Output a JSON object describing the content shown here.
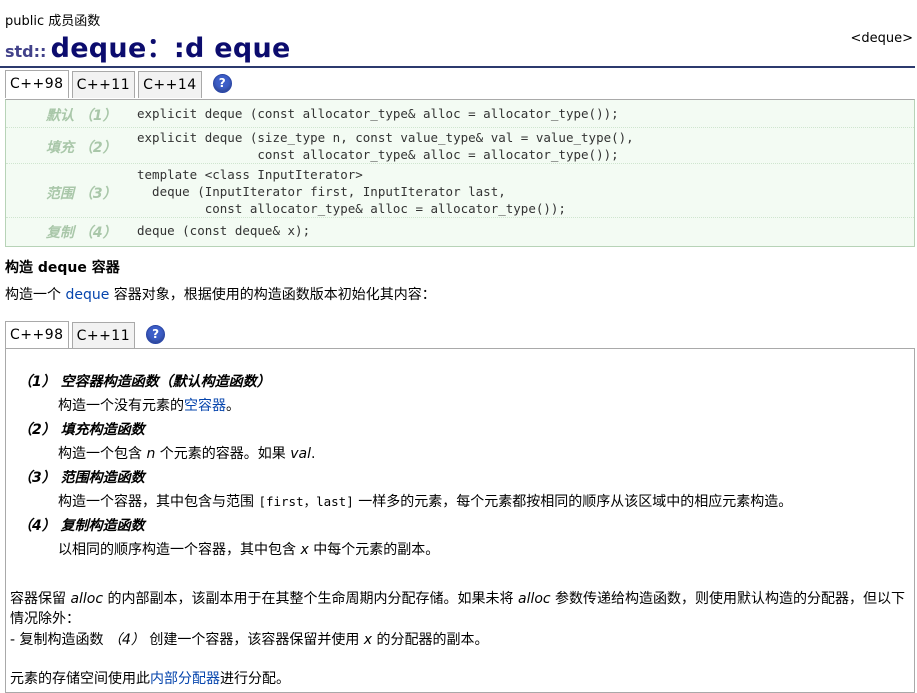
{
  "page": {
    "category": "public 成员函数",
    "namespace": "std::",
    "title": "deque：:d eque",
    "header_ref": "<deque>"
  },
  "proto_tabs": {
    "tabs": [
      "C++98",
      "C++11",
      "C++14"
    ],
    "active": "C++98",
    "help_icon": "?"
  },
  "prototypes": [
    {
      "label": "默认 （1）",
      "code": "explicit deque (const allocator_type& alloc = allocator_type());"
    },
    {
      "label": "填充 （2）",
      "code": "explicit deque (size_type n, const value_type& val = value_type(),\n                const allocator_type& alloc = allocator_type());"
    },
    {
      "label": "范围 （3）",
      "code": "template <class InputIterator>\n  deque (InputIterator first, InputIterator last,\n         const allocator_type& alloc = allocator_type());"
    },
    {
      "label": "复制 （4）",
      "code": "deque (const deque& x);"
    }
  ],
  "section": {
    "title": "构造 deque 容器",
    "intro_prefix": "构造一个",
    "intro_link": "deque",
    "intro_suffix": "容器对象，根据使用的构造函数版本初始化其内容："
  },
  "detail_tabs": {
    "tabs": [
      "C++98",
      "C++11"
    ],
    "active": "C++98",
    "help_icon": "?"
  },
  "items": [
    {
      "head": "（1） 空容器构造函数（默认构造函数）",
      "desc_pre": "构造一个没有元素的",
      "desc_link": "空容器",
      "desc_post": "。"
    },
    {
      "head": "（2） 填充构造函数",
      "desc_pre": "构造一个包含 ",
      "desc_var": "n",
      "desc_mid": " 个元素的容器。如果 ",
      "desc_var2": "val",
      "desc_post": "."
    },
    {
      "head": "（3） 范围构造函数",
      "desc_pre": "构造一个容器，其中包含与范围 ",
      "desc_range": "[first，last]",
      "desc_post": " 一样多的元素，每个元素都按相同的顺序从该区域中的相应元素构造。"
    },
    {
      "head": "（4） 复制构造函数",
      "desc_pre": "以相同的顺序构造一个容器，其中包含 ",
      "desc_var": "x",
      "desc_post": " 中每个元素的副本。"
    }
  ],
  "alloc_note": {
    "p1_a": "容器保留 ",
    "p1_var": "alloc",
    "p1_b": " 的内部副本，该副本用于在其整个生命周期内分配存储。如果未将 ",
    "p1_var2": "alloc",
    "p1_c": " 参数传递给构造函数，则使用默认构造的分配器，但以下情况除外：",
    "p2_a": "- 复制构造函数 ",
    "p2_ref": "（4）",
    "p2_b": " 创建一个容器，该容器保留并使用 ",
    "p2_var": "x",
    "p2_c": " 的分配器的副本。",
    "p3_a": "元素的存储空间使用此",
    "p3_link": "内部分配器",
    "p3_b": "进行分配。"
  }
}
